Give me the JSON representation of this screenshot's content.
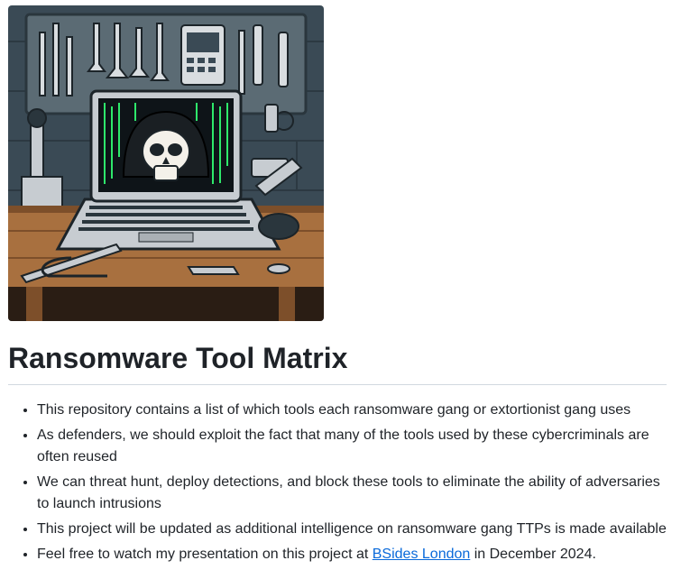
{
  "hero": {
    "icon": "hacker-workbench-illustration",
    "colors": {
      "wall": "#3a4a55",
      "pegboard": "#5b6b74",
      "table": "#a8703f",
      "laptop": "#c7ccd1",
      "screen": "#0e1418",
      "code": "#2ee86b",
      "skull": "#f4f1ea"
    }
  },
  "title": "Ransomware Tool Matrix",
  "bullets": [
    {
      "text": "This repository contains a list of which tools each ransomware gang or extortionist gang uses"
    },
    {
      "text": "As defenders, we should exploit the fact that many of the tools used by these cybercriminals are often reused"
    },
    {
      "text": "We can threat hunt, deploy detections, and block these tools to eliminate the ability of adversaries to launch intrusions"
    },
    {
      "text": "This project will be updated as additional intelligence on ransomware gang TTPs is made available"
    },
    {
      "prefix": "Feel free to watch my presentation on this project at ",
      "link_text": "BSides London",
      "suffix": " in December 2024."
    }
  ]
}
